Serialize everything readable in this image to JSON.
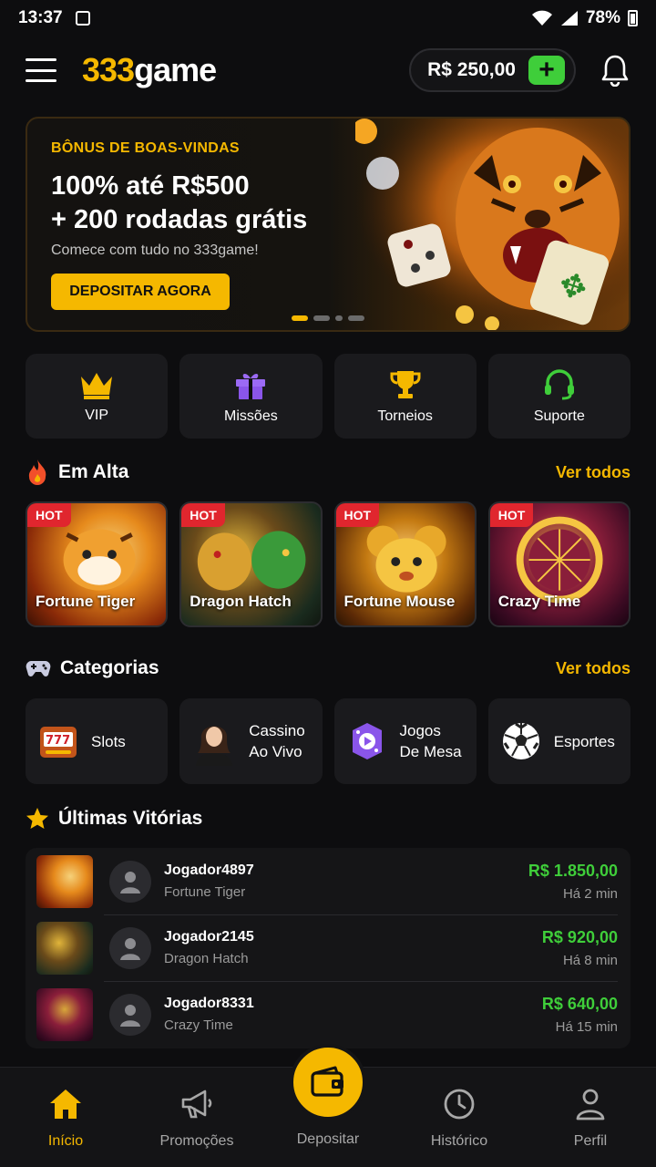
{
  "status": {
    "time": "13:37",
    "battery": "78%"
  },
  "header": {
    "logo_num": "333",
    "logo_txt": "game",
    "balance": "R$ 250,00",
    "add_label": "+"
  },
  "banner": {
    "kicker": "BÔNUS DE BOAS-VINDAS",
    "headline_1": "100% até R$500",
    "headline_2": "+ 200 rodadas grátis",
    "subtitle": "Comece com tudo no 333game!",
    "cta": "DEPOSITAR AGORA",
    "slides": 4,
    "active_slide": 1
  },
  "quick_actions": [
    {
      "label": "VIP",
      "icon": "crown-icon"
    },
    {
      "label": "Missões",
      "icon": "gift-icon"
    },
    {
      "label": "Torneios",
      "icon": "trophy-icon"
    },
    {
      "label": "Suporte",
      "icon": "headset-icon"
    }
  ],
  "hot": {
    "title": "Em Alta",
    "more": "Ver todos",
    "badge": "HOT",
    "games": [
      {
        "name": "Fortune Tiger"
      },
      {
        "name": "Dragon Hatch"
      },
      {
        "name": "Fortune Mouse"
      },
      {
        "name": "Crazy Time"
      }
    ]
  },
  "categories": {
    "title": "Categorias",
    "more": "Ver todos",
    "items": [
      {
        "label": "Slots",
        "icon": "slot-machine-icon"
      },
      {
        "label_1": "Cassino",
        "label_2": "Ao Vivo",
        "icon": "live-dealer-icon"
      },
      {
        "label_1": "Jogos",
        "label_2": "De Mesa",
        "icon": "table-games-icon"
      },
      {
        "label": "Esportes",
        "icon": "soccer-ball-icon"
      }
    ]
  },
  "wins": {
    "title": "Últimas Vitórias",
    "items": [
      {
        "player": "Jogador4897",
        "game": "Fortune Tiger",
        "amount": "R$ 1.850,00",
        "ago": "Há 2 min"
      },
      {
        "player": "Jogador2145",
        "game": "Dragon Hatch",
        "amount": "R$ 920,00",
        "ago": "Há 8 min"
      },
      {
        "player": "Jogador8331",
        "game": "Crazy Time",
        "amount": "R$ 640,00",
        "ago": "Há 15 min"
      }
    ]
  },
  "nav": [
    {
      "label": "Início",
      "icon": "home-icon",
      "active": true
    },
    {
      "label": "Promoções",
      "icon": "megaphone-icon"
    },
    {
      "label": "Depositar",
      "icon": "wallet-icon"
    },
    {
      "label": "Histórico",
      "icon": "clock-icon"
    },
    {
      "label": "Perfil",
      "icon": "user-icon"
    }
  ],
  "colors": {
    "accent": "#f5b800",
    "success": "#3fce3a",
    "hot_badge": "#e0262e",
    "background": "#0d0d0f"
  }
}
